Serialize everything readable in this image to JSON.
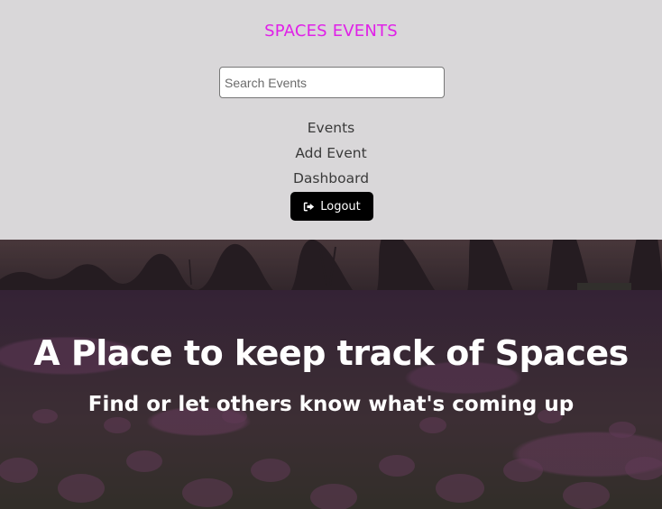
{
  "colors": {
    "brand": "#e020e8",
    "header_bg": "#d9d7d9",
    "button_bg": "#000000"
  },
  "header": {
    "brand": "SPACES EVENTS",
    "search": {
      "placeholder": "Search Events",
      "value": ""
    },
    "nav": [
      {
        "label": "Events"
      },
      {
        "label": "Add Event"
      },
      {
        "label": "Dashboard"
      }
    ],
    "logout": {
      "label": "Logout",
      "icon": "logout-icon"
    }
  },
  "hero": {
    "title": "A Place to keep track of Spaces",
    "subtitle": "Find or let others know what's coming up"
  }
}
